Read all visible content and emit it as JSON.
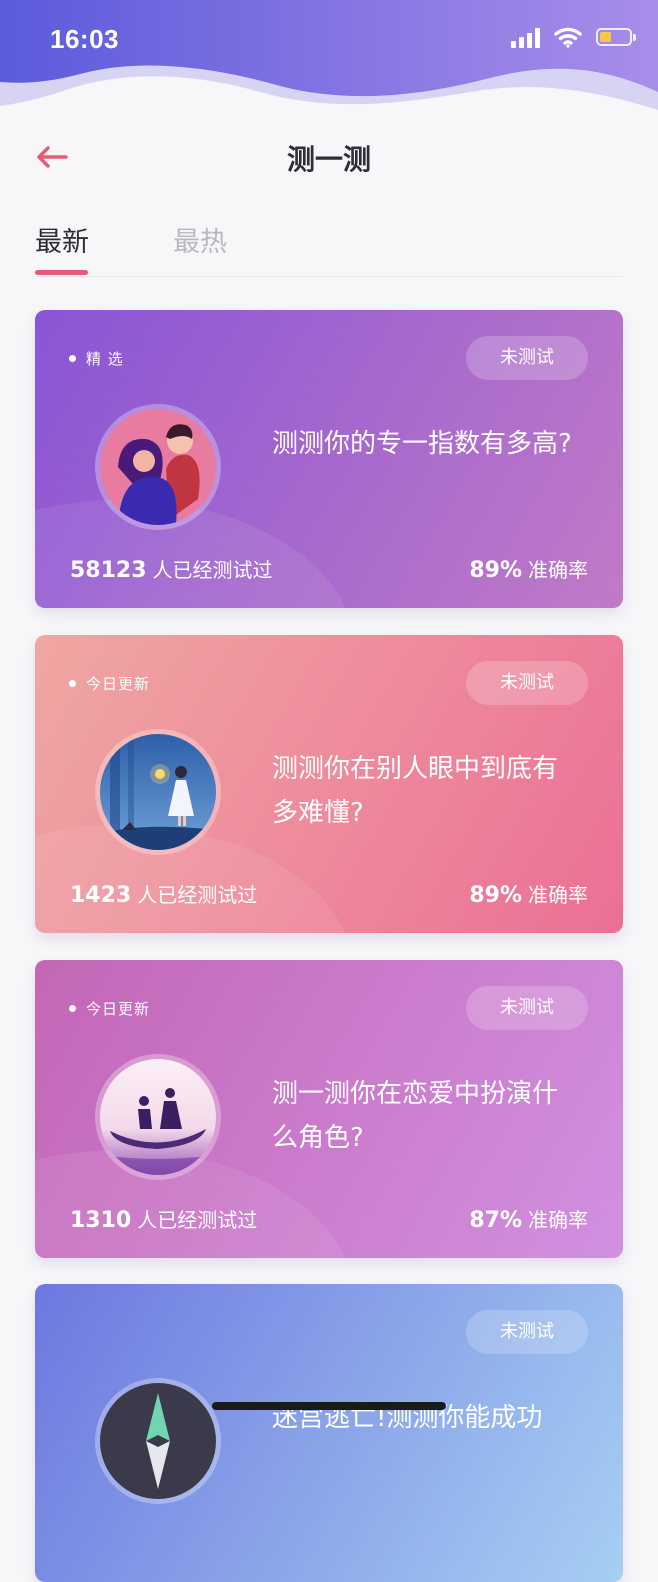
{
  "status_bar": {
    "time": "16:03",
    "battery_level": 0.4
  },
  "header": {
    "title": "测一测",
    "back_icon": "arrow-left-icon"
  },
  "tabs": [
    {
      "label": "最新",
      "active": true
    },
    {
      "label": "最热",
      "active": false
    }
  ],
  "colors": {
    "accent": "#e85a78",
    "title": "#2f2f3a",
    "inactive_tab": "#b8b8c2"
  },
  "cards": [
    {
      "tag": "精 选",
      "badge": "未测试",
      "title": "测测你的专一指数有多高?",
      "count": "58123",
      "count_suffix": "人已经测试过",
      "rate": "89%",
      "rate_suffix": "准确率",
      "gradient": [
        "#8a55d6",
        "#c07ac6"
      ],
      "image_icon": "couple-illustration"
    },
    {
      "tag": "今日更新",
      "badge": "未测试",
      "title": "测测你在别人眼中到底有多难懂?",
      "count": "1423",
      "count_suffix": "人已经测试过",
      "rate": "89%",
      "rate_suffix": "准确率",
      "gradient": [
        "#efa7a2",
        "#ec6f95"
      ],
      "image_icon": "girl-lantern-illustration"
    },
    {
      "tag": "今日更新",
      "badge": "未测试",
      "title": "测一测你在恋爱中扮演什么角色?",
      "count": "1310",
      "count_suffix": "人已经测试过",
      "rate": "87%",
      "rate_suffix": "准确率",
      "gradient": [
        "#c466b6",
        "#d190e0"
      ],
      "image_icon": "gondola-couple-illustration"
    },
    {
      "tag": "",
      "badge": "未测试",
      "title": "迷宫逃亡!测测你能成功",
      "count": "",
      "count_suffix": "",
      "rate": "",
      "rate_suffix": "",
      "gradient": [
        "#6d78df",
        "#a6cff2"
      ],
      "image_icon": "compass-illustration"
    }
  ]
}
